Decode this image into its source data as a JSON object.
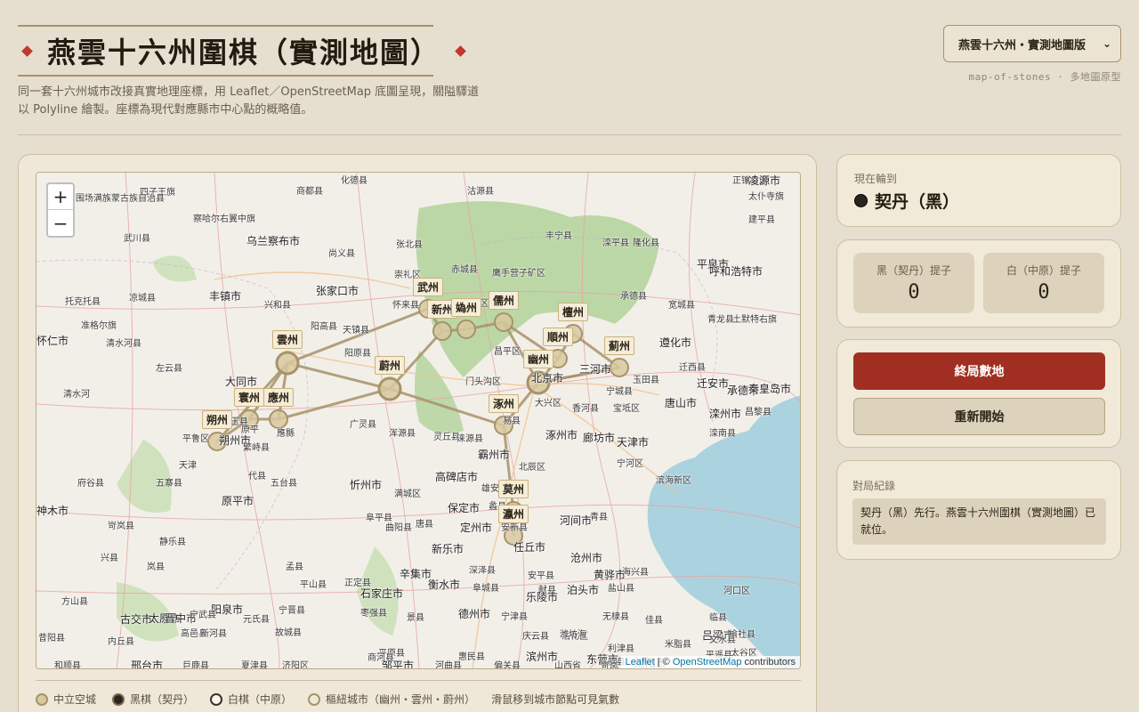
{
  "header": {
    "title": "燕雲十六州圍棋（實測地圖）",
    "subtitle": "同一套十六州城市改接真實地理座標，用 Leaflet／OpenStreetMap 底圖呈現，關隘驛道以 Polyline 繪製。座標為現代對應縣市中心點的概略值。",
    "select_value": "燕雲十六州・實測地圖版",
    "tagline": "map-of-stones · 多地圖原型"
  },
  "map": {
    "zoom_in": "+",
    "zoom_out": "−",
    "attribution_leaflet": "Leaflet",
    "attribution_sep": " | © ",
    "attribution_osm": "OpenStreetMap",
    "attribution_tail": " contributors",
    "cities": [
      {
        "id": "wu",
        "name": "武州"
      },
      {
        "id": "xin",
        "name": "新州"
      },
      {
        "id": "gui",
        "name": "媯州"
      },
      {
        "id": "ru",
        "name": "儒州"
      },
      {
        "id": "tan",
        "name": "檀州"
      },
      {
        "id": "shun",
        "name": "順州"
      },
      {
        "id": "ji",
        "name": "薊州"
      },
      {
        "id": "you",
        "name": "幽州"
      },
      {
        "id": "yun",
        "name": "雲州"
      },
      {
        "id": "wei",
        "name": "蔚州"
      },
      {
        "id": "huan",
        "name": "寰州"
      },
      {
        "id": "ying",
        "name": "應州"
      },
      {
        "id": "shuo",
        "name": "朔州"
      },
      {
        "id": "zhuo",
        "name": "涿州"
      },
      {
        "id": "mo",
        "name": "莫州"
      },
      {
        "id": "yingz",
        "name": "瀛州"
      }
    ],
    "place_labels": [
      "四子王旗",
      "商都县",
      "化德县",
      "沽源县",
      "正镶白旗",
      "太仆寺旗",
      "围场满族蒙古族自治县",
      "承德市",
      "宁城县",
      "凌源市",
      "建平县",
      "武川县",
      "察哈尔右翼中旗",
      "乌兰察布市",
      "尚义县",
      "张北县",
      "丰宁县",
      "隆化县",
      "滦平县",
      "平泉市",
      "呼和浩特市",
      "凉城县",
      "丰镇市",
      "兴和县",
      "张家口市",
      "崇礼区",
      "赤城县",
      "鹰手营子矿区",
      "承德县",
      "宽城县",
      "青龙县",
      "土默特右旗",
      "托克托县",
      "准格尔旗",
      "清水河县",
      "左云县",
      "大同市",
      "阳高县",
      "天镇县",
      "阳原县",
      "怀来县",
      "延庆区",
      "昌平区",
      "北京市",
      "门头沟区",
      "大兴区",
      "香河县",
      "宝坻区",
      "三河市",
      "遵化市",
      "玉田县",
      "迁西县",
      "迁安市",
      "唐山市",
      "秦皇岛市",
      "昌黎县",
      "滦州市",
      "滦南县",
      "右玉县",
      "平鲁区",
      "朔州市",
      "广灵县",
      "浑源县",
      "灵丘县",
      "涞源县",
      "易县",
      "涿州市",
      "廊坊市",
      "天津市",
      "宁河区",
      "北辰区",
      "霸州市",
      "高碑店市",
      "雄安新区",
      "保定市",
      "满城区",
      "唐县",
      "定州市",
      "蠡县",
      "安新县",
      "任丘市",
      "河间市",
      "青县",
      "滨海新区",
      "黄骅市",
      "沧州市",
      "海兴县",
      "河口区",
      "府谷县",
      "五寨县",
      "代县",
      "繁峙县",
      "原平市",
      "五台县",
      "忻州市",
      "阜平县",
      "曲阳县",
      "新乐市",
      "深泽县",
      "安平县",
      "献县",
      "泊头市",
      "盐山县",
      "神木市",
      "岢岚县",
      "静乐县",
      "兴县",
      "岚县",
      "孟县",
      "平山县",
      "正定县",
      "石家庄市",
      "辛集市",
      "衡水市",
      "阜城县",
      "乐陵市",
      "无棣县",
      "佳县",
      "临县",
      "方山县",
      "古交市",
      "太原市",
      "晋中市",
      "阳泉市",
      "元氏县",
      "宁晋县",
      "枣强县",
      "景县",
      "德州市",
      "宁津县",
      "庆云县",
      "沾化区",
      "利津县",
      "东营市",
      "米脂县",
      "吕梁市",
      "文水县",
      "太谷区",
      "昔阳县",
      "内丘县",
      "高邑县",
      "新河县",
      "故城县",
      "平原县",
      "商河县",
      "惠民县",
      "滨州市",
      "潍坊海",
      "绥德县",
      "汾阳市",
      "平遥县",
      "榆社县",
      "和顺县",
      "邢台市",
      "巨鹿县",
      "夏津县",
      "济阳区",
      "邹平市",
      "河曲县",
      "偏关县",
      "山西省",
      "岢岚",
      "怀仁市",
      "清水河",
      "宁武县",
      "原平",
      "應縣",
      "天津"
    ]
  },
  "legend": [
    {
      "kind": "neutral",
      "label": "中立空城"
    },
    {
      "kind": "black",
      "label": "黑棋（契丹）"
    },
    {
      "kind": "white",
      "label": "白棋（中原）"
    },
    {
      "kind": "hub",
      "label": "樞紐城市（幽州・雲州・蔚州）"
    }
  ],
  "legend_hint": "滑鼠移到城市節點可見氣數",
  "turn": {
    "label": "現在輪到",
    "value": "契丹（黑）"
  },
  "captures": {
    "black_label": "黑（契丹）提子",
    "black_value": "0",
    "white_label": "白（中原）提子",
    "white_value": "0"
  },
  "buttons": {
    "score": "終局數地",
    "restart": "重新開始"
  },
  "log": {
    "title": "對局紀錄",
    "entry": "契丹（黑）先行。燕雲十六州圍棋（實測地圖）已就位。"
  },
  "colors": {
    "accent_red": "#a02f22",
    "stone_black": "#2b2520",
    "gold": "#a7936a",
    "sea": "#aad3df"
  }
}
